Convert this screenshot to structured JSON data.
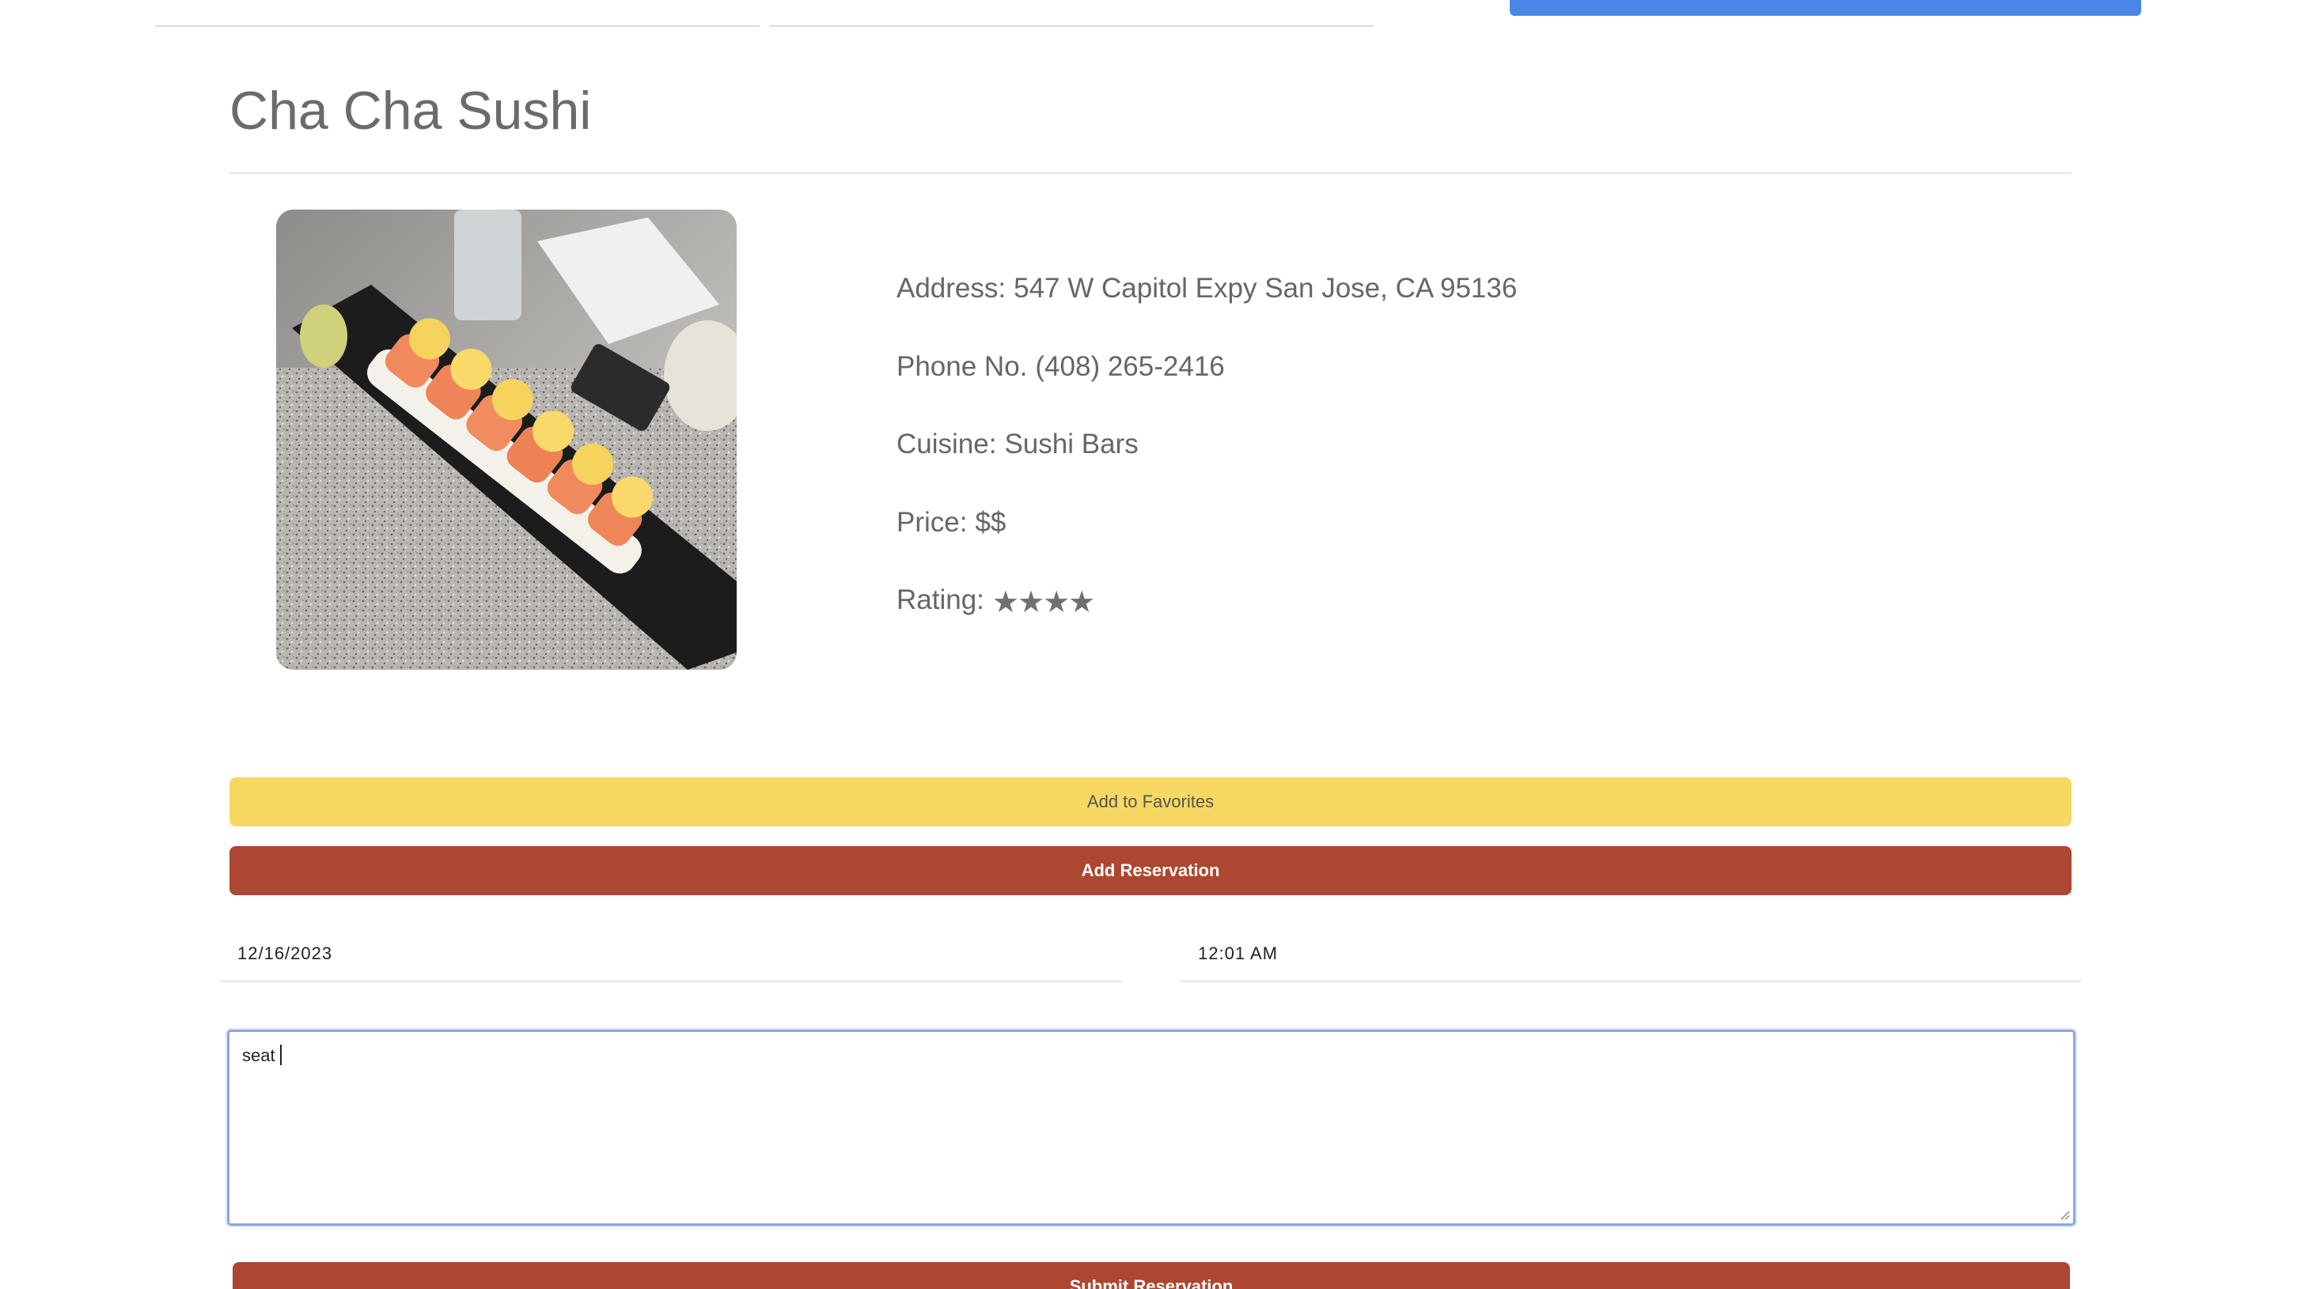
{
  "restaurant": {
    "name": "Cha Cha Sushi",
    "photo_icon": "sushi-photo",
    "address_label": "Address:",
    "address": "547 W Capitol Expy San Jose, CA 95136",
    "phone_label": "Phone No.",
    "phone": "(408) 265-2416",
    "cuisine_label": "Cuisine:",
    "cuisine": "Sushi Bars",
    "price_label": "Price:",
    "price": "$$",
    "rating_label": "Rating:",
    "rating_stars": 4
  },
  "actions": {
    "favorites_label": "Add to Favorites",
    "reservation_label": "Add Reservation",
    "submit_label": "Submit Reservation"
  },
  "reservation": {
    "date": "12/16/2023",
    "time": "12:01 AM",
    "note": "seat"
  },
  "colors": {
    "favorites_button": "#f7d863",
    "reservation_button": "#ad4732",
    "top_button": "#4a86e8",
    "focus_border": "#8aa7e0"
  }
}
